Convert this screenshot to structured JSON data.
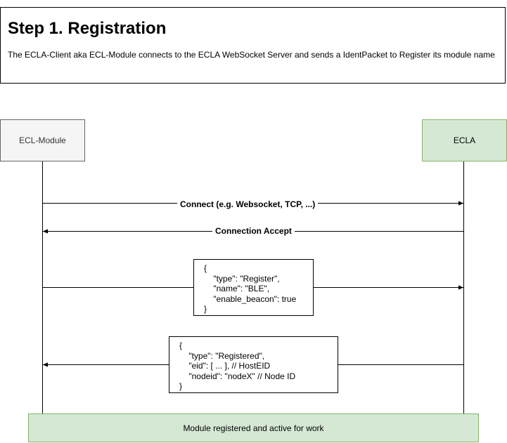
{
  "header": {
    "title": "Step 1. Registration",
    "description": "The ECLA-Client aka ECL-Module connects to the ECLA WebSocket Server and sends a IdentPacket to Register its module name"
  },
  "participants": {
    "left": {
      "label": "ECL-Module"
    },
    "right": {
      "label": "ECLA"
    }
  },
  "messages": {
    "connect": {
      "label": "Connect (e.g. Websocket, TCP, ...)",
      "direction": "left-to-right"
    },
    "accept": {
      "label": "Connection Accept",
      "direction": "right-to-left"
    },
    "register": {
      "direction": "left-to-right",
      "payload": "{\n    \"type\": \"Register\",\n    \"name\": \"BLE\",\n    \"enable_beacon\": true\n}"
    },
    "registered": {
      "direction": "right-to-left",
      "payload": "{\n    \"type\": \"Registered\",\n    \"eid\": [ ... ], // HostEID\n    \"nodeid\": \"nodeX\" // Node ID\n}"
    }
  },
  "footer": {
    "label": "Module registered and active for work"
  },
  "colors": {
    "left_fill": "#f5f5f5",
    "left_stroke": "#666666",
    "right_fill": "#d5e8d4",
    "right_stroke": "#82b366"
  }
}
